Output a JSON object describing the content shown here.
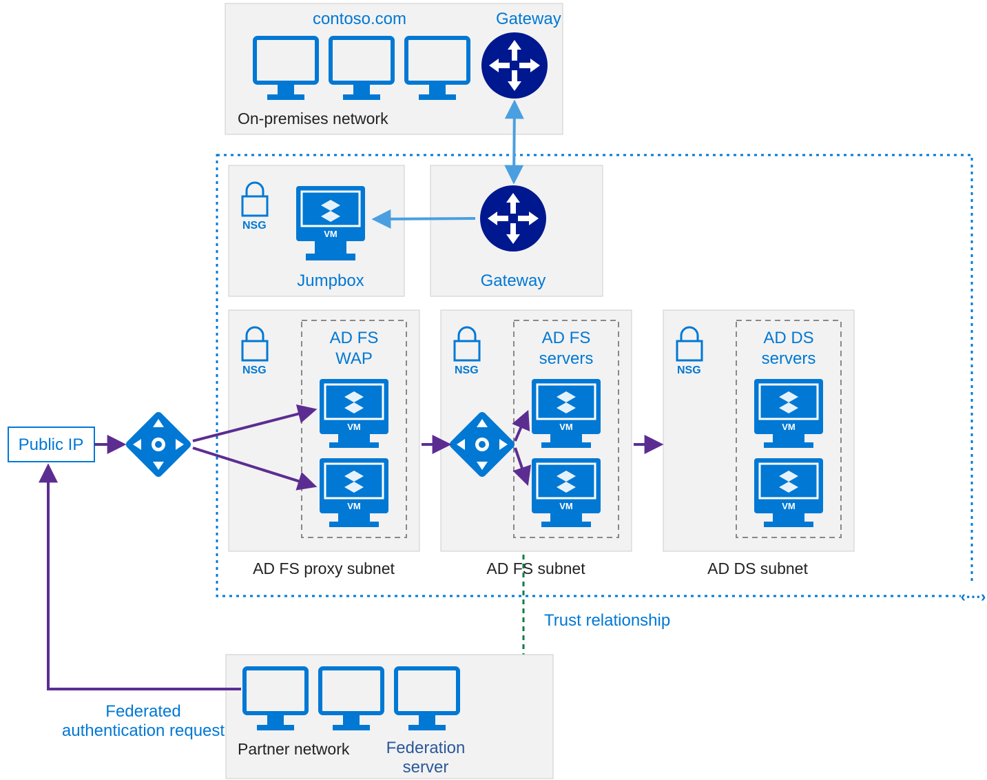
{
  "onprem": {
    "title": "contoso.com",
    "gateway": "Gateway",
    "label": "On-premises network"
  },
  "azure": {
    "jumpbox": {
      "nsg": "NSG",
      "label": "Jumpbox"
    },
    "gateway": "Gateway",
    "wap": {
      "nsg": "NSG",
      "title1": "AD FS",
      "title2": "WAP",
      "subnet": "AD FS proxy subnet"
    },
    "adfs": {
      "nsg": "NSG",
      "title1": "AD FS",
      "title2": "servers",
      "subnet": "AD FS subnet"
    },
    "adds": {
      "nsg": "NSG",
      "title1": "AD DS",
      "title2": "servers",
      "subnet": "AD DS subnet"
    }
  },
  "publicIp": "Public IP",
  "trust": "Trust relationship",
  "fedRequest1": "Federated",
  "fedRequest2": "authentication request",
  "partner": {
    "label": "Partner network",
    "fedserver1": "Federation",
    "fedserver2": "server"
  },
  "vm": "VM"
}
